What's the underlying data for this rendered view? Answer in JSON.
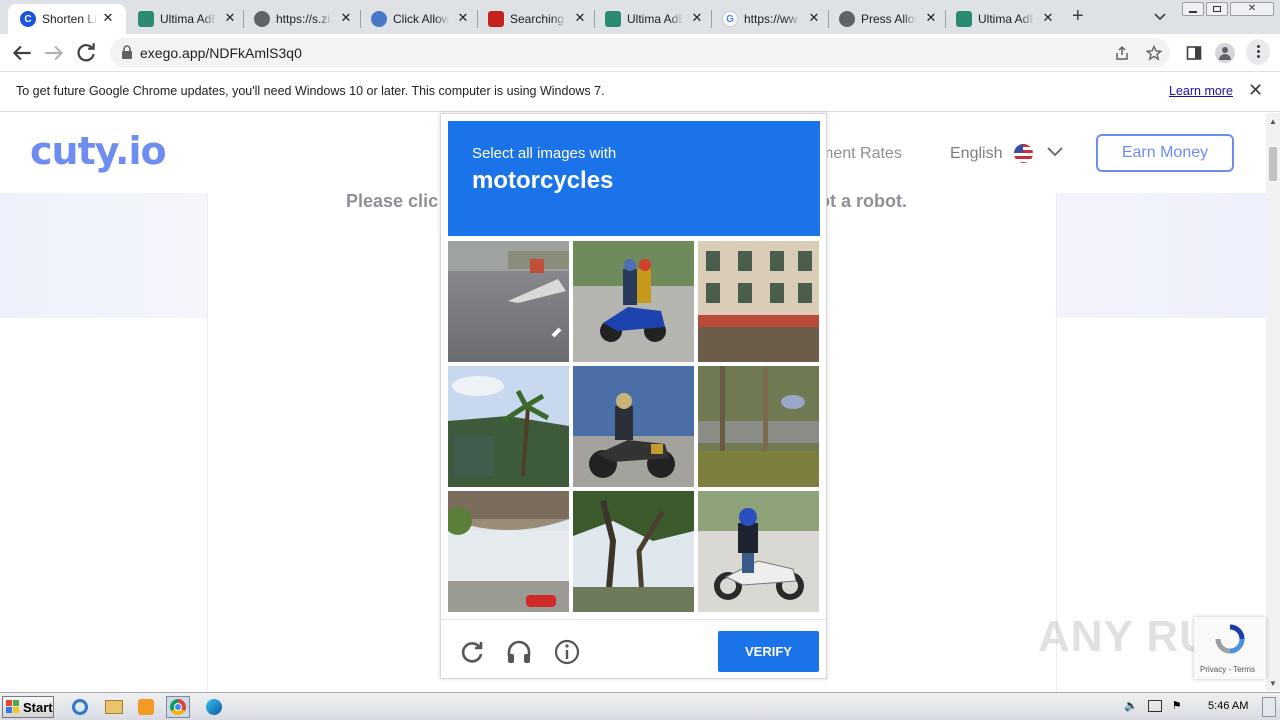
{
  "browser": {
    "tabs": [
      {
        "title": "Shorten Links & Earn",
        "favicon": "cuty-icon",
        "active": true
      },
      {
        "title": "Ultima AdBlocker",
        "favicon": "shield-icon",
        "active": false
      },
      {
        "title": "https://s.zi",
        "favicon": "globe-icon",
        "active": false
      },
      {
        "title": "Click Allow",
        "favicon": "refresh-icon",
        "active": false
      },
      {
        "title": "Searching f",
        "favicon": "search-icon",
        "active": false
      },
      {
        "title": "Ultima AdBlocker",
        "favicon": "shield-icon",
        "active": false
      },
      {
        "title": "https://ww",
        "favicon": "google-icon",
        "active": false
      },
      {
        "title": "Press Allow",
        "favicon": "globe-icon",
        "active": false
      },
      {
        "title": "Ultima AdBlocker",
        "favicon": "shield-icon",
        "active": false
      }
    ],
    "new_tab_label": "+",
    "url": "exego.app/NDFkAmlS3q0"
  },
  "infobar": {
    "message": "To get future Google Chrome updates, you'll need Windows 10 or later. This computer is using Windows 7.",
    "learn_more": "Learn more"
  },
  "site": {
    "logo": "cuty.io",
    "nav_rates": "yment Rates",
    "language": "English",
    "earn_button": "Earn Money",
    "please_left": "Please clic",
    "please_right": "ot a robot."
  },
  "captcha": {
    "instruction": "Select all images with",
    "object": "motorcycles",
    "verify_label": "VERIFY",
    "tiles": [
      {
        "scene": "road-crossing"
      },
      {
        "scene": "motorcycle-two-riders"
      },
      {
        "scene": "shophouse-building"
      },
      {
        "scene": "palm-trees-house"
      },
      {
        "scene": "motorcycle-rider"
      },
      {
        "scene": "street-trees"
      },
      {
        "scene": "overpass-road"
      },
      {
        "scene": "tree-trunk"
      },
      {
        "scene": "motorcycle-rider-helmet"
      }
    ]
  },
  "watermark": "ANY RUN",
  "recaptcha_badge": "Privacy - Terms",
  "taskbar": {
    "start_label": "Start",
    "clock": "5:46 AM"
  }
}
